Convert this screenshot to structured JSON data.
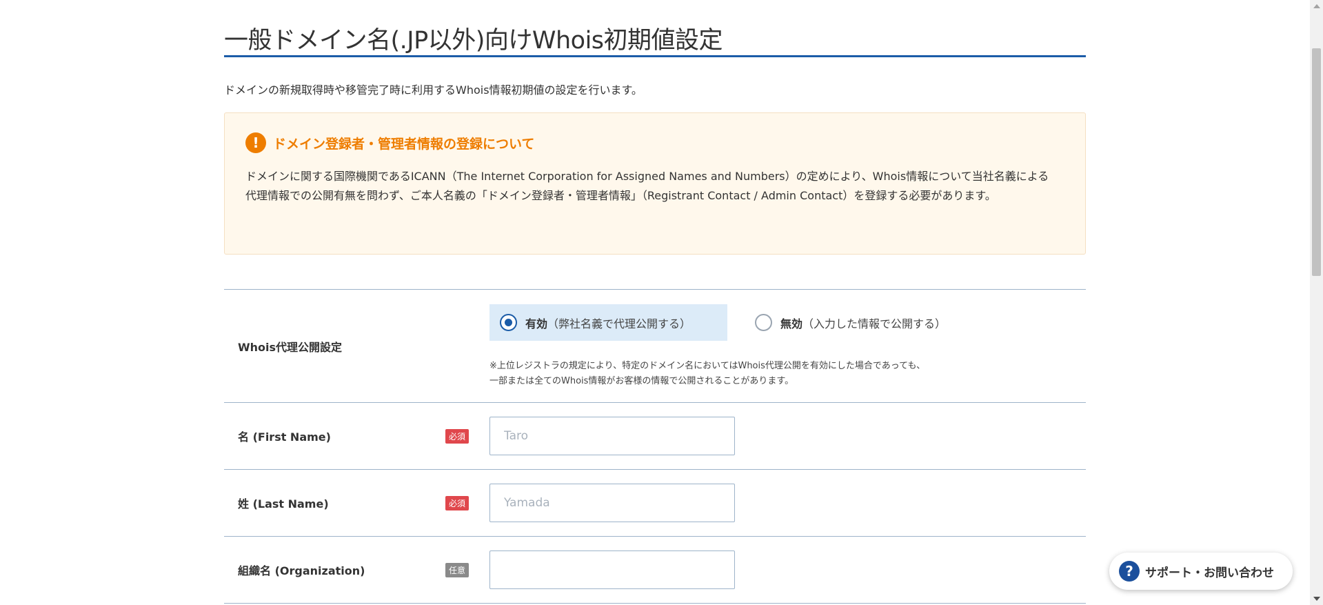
{
  "page": {
    "title": "一般ドメイン名(.JP以外)向けWhois初期値設定",
    "description": "ドメインの新規取得時や移管完了時に利用するWhois情報初期値の設定を行います。"
  },
  "notice": {
    "icon": "exclamation-icon",
    "icon_glyph": "!",
    "title": "ドメイン登録者・管理者情報の登録について",
    "body": "ドメインに関する国際機関であるICANN（The Internet Corporation for Assigned Names and Numbers）の定めにより、Whois情報について当社名義による代理情報での公開有無を問わず、ご本人名義の「ドメイン登録者・管理者情報」（Registrant Contact / Admin Contact）を登録する必要があります。"
  },
  "form": {
    "proxy": {
      "label": "Whois代理公開設定",
      "options": [
        {
          "strong": "有効",
          "sub": "（弊社名義で代理公開する）",
          "selected": true
        },
        {
          "strong": "無効",
          "sub": "（入力した情報で公開する）",
          "selected": false
        }
      ],
      "note_line1": "※上位レジストラの規定により、特定のドメイン名においてはWhois代理公開を有効にした場合であっても、",
      "note_line2": "一部または全てのWhois情報がお客様の情報で公開されることがあります。"
    },
    "first_name": {
      "label": "名 (First Name)",
      "badge": "必須",
      "placeholder": "Taro",
      "value": ""
    },
    "last_name": {
      "label": "姓 (Last Name)",
      "badge": "必須",
      "placeholder": "Yamada",
      "value": ""
    },
    "organization": {
      "label": "組織名 (Organization)",
      "badge": "任意",
      "placeholder": "",
      "value": ""
    }
  },
  "support": {
    "icon": "question-icon",
    "icon_glyph": "?",
    "label": "サポート・お問い合わせ"
  },
  "colors": {
    "accent": "#1b5ca8",
    "warning": "#ee7d00",
    "required": "#e0474c",
    "optional": "#8a8a8a"
  }
}
